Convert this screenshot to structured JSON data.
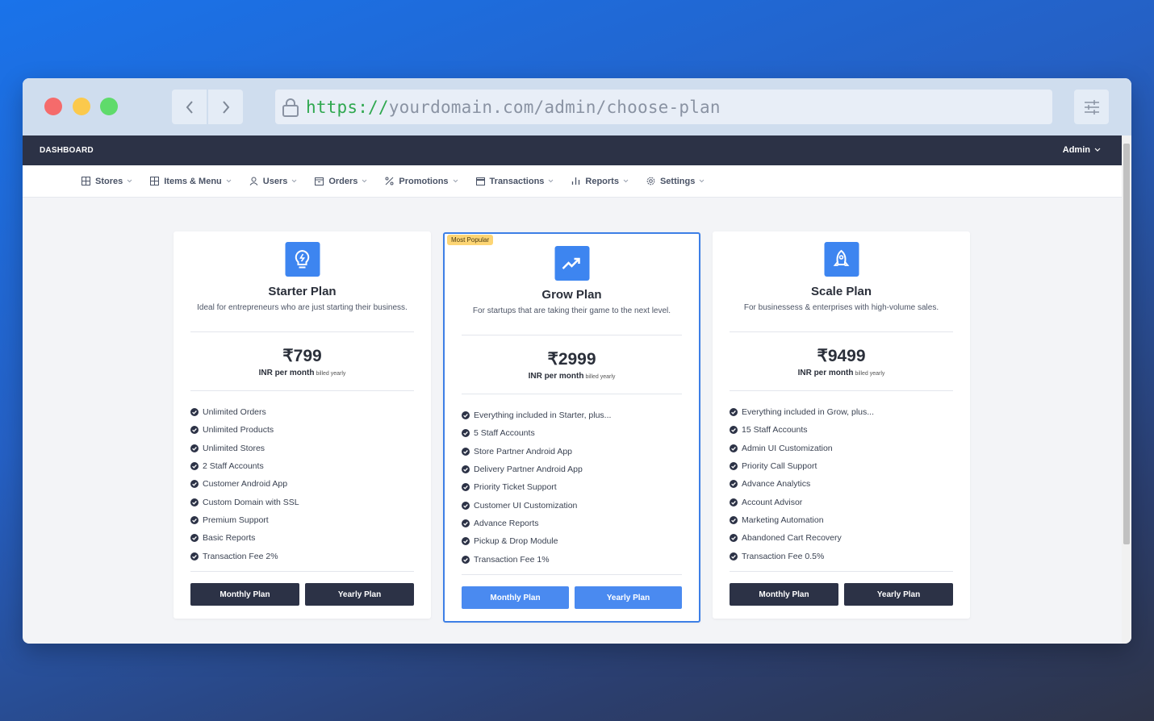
{
  "browser": {
    "url_protocol": "https://",
    "url_rest": "yourdomain.com/admin/choose-plan"
  },
  "topbar": {
    "brand": "DASHBOARD",
    "user": "Admin"
  },
  "menu": [
    {
      "label": "Stores",
      "icon": "grid-icon"
    },
    {
      "label": "Items & Menu",
      "icon": "grid-icon"
    },
    {
      "label": "Users",
      "icon": "user-icon"
    },
    {
      "label": "Orders",
      "icon": "box-icon"
    },
    {
      "label": "Promotions",
      "icon": "percent-icon"
    },
    {
      "label": "Transactions",
      "icon": "calendar-icon"
    },
    {
      "label": "Reports",
      "icon": "bar-chart-icon"
    },
    {
      "label": "Settings",
      "icon": "gear-icon"
    }
  ],
  "plans": [
    {
      "name": "Starter Plan",
      "icon": "lightbulb-icon",
      "description": "Ideal for entrepreneurs who are just starting their business.",
      "price": "₹799",
      "billing": "INR per month",
      "billing_note": "billed yearly",
      "features": [
        "Unlimited Orders",
        "Unlimited Products",
        "Unlimited Stores",
        "2 Staff Accounts",
        "Customer Android App",
        "Custom Domain with SSL",
        "Premium Support",
        "Basic Reports",
        "Transaction Fee 2%"
      ],
      "monthly_label": "Monthly Plan",
      "yearly_label": "Yearly Plan"
    },
    {
      "name": "Grow Plan",
      "icon": "trending-up-icon",
      "badge": "Most Popular",
      "description": "For startups that are taking their game to the next level.",
      "price": "₹2999",
      "billing": "INR per month",
      "billing_note": "billed yearly",
      "features": [
        "Everything included in Starter, plus...",
        "5 Staff Accounts",
        "Store Partner Android App",
        "Delivery Partner Android App",
        "Priority Ticket Support",
        "Customer UI Customization",
        "Advance Reports",
        "Pickup & Drop Module",
        "Transaction Fee 1%"
      ],
      "monthly_label": "Monthly Plan",
      "yearly_label": "Yearly Plan"
    },
    {
      "name": "Scale Plan",
      "icon": "rocket-icon",
      "description": "For businessess & enterprises with high-volume sales.",
      "price": "₹9499",
      "billing": "INR per month",
      "billing_note": "billed yearly",
      "features": [
        "Everything included in Grow, plus...",
        "15 Staff Accounts",
        "Admin UI Customization",
        "Priority Call Support",
        "Advance Analytics",
        "Account Advisor",
        "Marketing Automation",
        "Abandoned Cart Recovery",
        "Transaction Fee 0.5%"
      ],
      "monthly_label": "Monthly Plan",
      "yearly_label": "Yearly Plan"
    }
  ],
  "colors": {
    "accent": "#3d85f0",
    "dark": "#2c3246",
    "badge": "#fdd574"
  }
}
